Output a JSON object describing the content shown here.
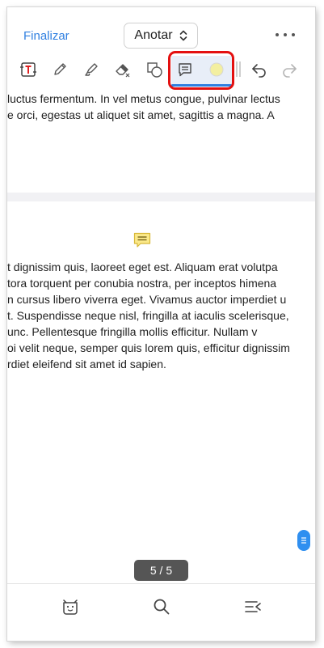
{
  "header": {
    "finish_label": "Finalizar",
    "mode_label": "Anotar"
  },
  "toolbar": {
    "tools": [
      "text-box",
      "pencil",
      "highlighter",
      "eraser",
      "shapes",
      "note",
      "color",
      "undo",
      "redo"
    ],
    "active_tool": "note",
    "selected_color": "#f3efa0",
    "accent": "#2f7fe0",
    "highlight_outline_color": "#e41010"
  },
  "document": {
    "page1_lines": [
      "luctus fermentum. In vel metus congue, pulvinar lectus",
      "e orci, egestas ut aliquet sit amet, sagittis a magna. A"
    ],
    "page2_lines": [
      "t dignissim quis, laoreet eget est. Aliquam erat volutpa",
      "tora torquent per conubia nostra, per inceptos himena",
      "n cursus libero viverra eget. Vivamus auctor imperdiet u",
      "t. Suspendisse neque nisl, fringilla at iaculis scelerisque,",
      "unc. Pellentesque fringilla mollis efficitur. Nullam v",
      "oi velit neque, semper quis lorem quis, efficitur dignissim",
      "rdiet eleifend sit amet id sapien."
    ]
  },
  "page_indicator": "5 / 5",
  "bottom_bar": {
    "items": [
      "bookmark",
      "search",
      "outline"
    ]
  }
}
